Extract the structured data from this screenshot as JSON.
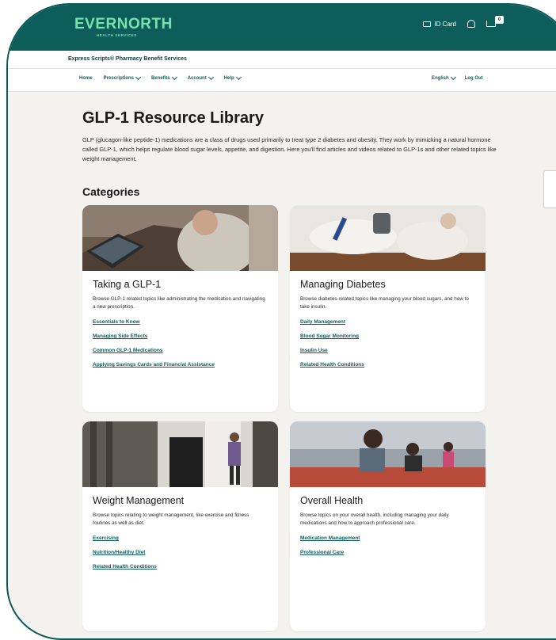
{
  "header": {
    "logo": "EVERNORTH",
    "logo_sub": "HEALTH SERVICES",
    "id_card_label": "ID Card",
    "cart_count": "0"
  },
  "subheader": {
    "title": "Express Scripts® Pharmacy Benefit Services"
  },
  "nav": {
    "items": [
      {
        "label": "Home",
        "dropdown": false
      },
      {
        "label": "Prescriptions",
        "dropdown": true
      },
      {
        "label": "Benefits",
        "dropdown": true
      },
      {
        "label": "Account",
        "dropdown": true
      },
      {
        "label": "Help",
        "dropdown": true
      }
    ],
    "language": "English",
    "logout": "Log Out"
  },
  "main": {
    "title": "GLP-1 Resource Library",
    "intro": "GLP (glucagon-like peptide-1) medications are a class of drugs used primarily to treat type 2 diabetes and obesity. They work by mimicking a natural hormone called GLP-1, which helps regulate blood sugar levels, appetite, and digestion. Here you'll find articles and videos related to GLP-1s and other related topics like weight management.",
    "categories_heading": "Categories",
    "cards": [
      {
        "title": "Taking a GLP-1",
        "desc": "Browse GLP-1 related topics like administrating the medication and navigating a new prescription.",
        "links": [
          "Essentials to Know",
          "Managing Side Effects",
          "Common GLP-1 Medications",
          "Applying Savings Cards and Financial Assistance"
        ]
      },
      {
        "title": "Managing Diabetes",
        "desc": "Browse diabetes-related topics like managing your blood sugars, and how to take insulin.",
        "links": [
          "Daily Management",
          "Blood Sugar Monitoring",
          "Insulin Use",
          "Related Health Conditions"
        ]
      },
      {
        "title": "Weight Management",
        "desc": "Browse topics relating to weight management, like exercise and fitness routines as well as diet.",
        "links": [
          "Exercising",
          "Nutrition/Healthy Diet",
          "Related Health Conditions"
        ]
      },
      {
        "title": "Overall Health",
        "desc": "Browse topics on your overall health, including managing your daily medications and how to approach professional care.",
        "links": [
          "Medication Management",
          "Professional Care"
        ]
      }
    ]
  },
  "colors": {
    "brand": "#0d5e5a",
    "accent": "#79e2a8",
    "background": "#f3f2ef"
  }
}
